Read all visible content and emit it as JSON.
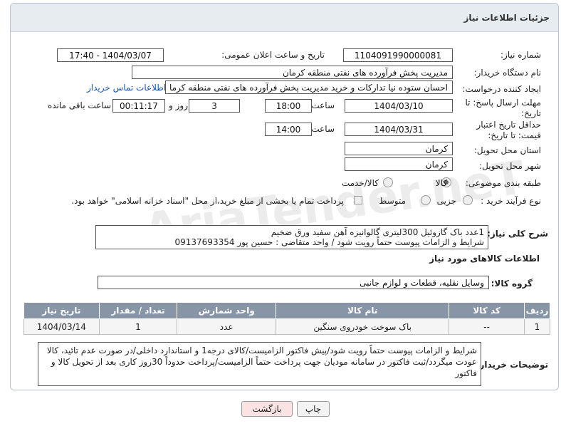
{
  "header": {
    "title": "جزئیات اطلاعات نیاز"
  },
  "fields": {
    "need_number_label": "شماره نیاز:",
    "need_number": "1104091990000081",
    "announce_label": "تاریخ و ساعت اعلان عمومی:",
    "announce_value": "1404/03/07 - 17:40",
    "buyer_label": "نام دستگاه خریدار:",
    "buyer": "مدیریت پخش فرآورده های نفتی منطقه کرمان",
    "requester_label": "ایجاد کننده درخواست:",
    "requester": "احسان ستوده نیا تدارکات و خرید مدیریت پخش فرآورده های نفتی منطقه کرما",
    "contact_link": "اطلاعات تماس خریدار",
    "deadline_label": "مهلت ارسال پاسخ: تا تاریخ:",
    "deadline_date": "1404/03/10",
    "time_label": "ساعت",
    "deadline_time": "18:00",
    "days": "3",
    "days_label": "روز و",
    "remaining": "00:11:17",
    "remaining_label": "ساعت باقی مانده",
    "validity_label": "حداقل تاریخ اعتبار قیمت: تا تاریخ:",
    "validity_date": "1404/03/31",
    "validity_time": "14:00",
    "province_label": "استان محل تحویل:",
    "province": "کرمان",
    "city_label": "شهر محل تحویل:",
    "city": "کرمان",
    "category_label": "طبقه بندی موضوعی:",
    "cat_goods": "کالا",
    "cat_goods_service": "کالا/خدمت",
    "process_label": "نوع فرآیند خرید :",
    "proc_partial": "جزیی",
    "proc_medium": "متوسط",
    "payment_note": "پرداخت تمام یا بخشی از مبلغ خرید،از محل \"اسناد خزانه اسلامی\" خواهد بود."
  },
  "description": {
    "label": "شرح کلی نیاز:",
    "line1": "1عدد باک گازوئیل 300لیتری گالوانیزه آهن سفید ورق ضخیم",
    "line2": "شرایط و الزامات پیوست حتماً رویت شود / واحد متقاضی : حسین پور 09137693354"
  },
  "goods_section": {
    "title": "اطلاعات کالاهای مورد نیاز",
    "group_label": "گروه کالا:",
    "group_value": "وسایل نقلیه، قطعات و لوازم جانبی"
  },
  "table": {
    "headers": [
      "ردیف",
      "کد کالا",
      "نام کالا",
      "واحد شمارش",
      "تعداد / مقدار",
      "تاریخ نیاز"
    ],
    "rows": [
      [
        "1",
        "--",
        "باک سوخت خودروی سنگین",
        "عدد",
        "1",
        "1404/03/14"
      ]
    ]
  },
  "notes": {
    "label": "توضیحات خریدار:",
    "text": "شرایط و الزامات پیوست حتماً رویت شود/پیش فاکتور الزامیست/کالای درجه1 و استاندارد داخلی/در صورت عدم تائید، کالا عودت میگردد/ثبت فاکتور در سامانه مودیان جهت پرداخت حتماً الزامیست/پرداخت حدوداً 30روز کاری بعد از تحویل کالا و فاکتور"
  },
  "buttons": {
    "print": "چاپ",
    "back": "بازگشت"
  },
  "watermark": "AriaTender.neT",
  "colors": {
    "table_header": "#8795a6",
    "back_button": "#fbe3e3",
    "link": "#1a55b0"
  }
}
